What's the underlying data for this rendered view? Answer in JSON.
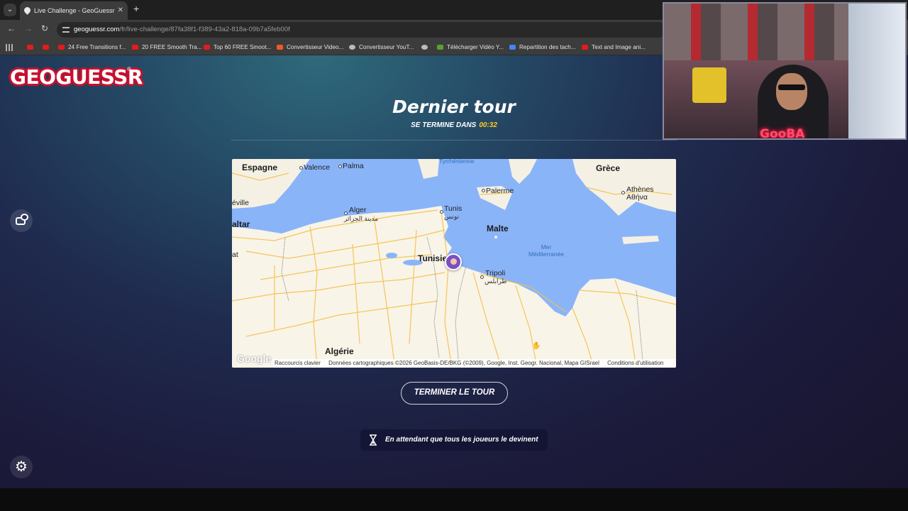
{
  "browser": {
    "tab_title": "Live Challenge - GeoGuessr",
    "url_host": "geoguessr.com",
    "url_path": "/fr/live-challenge/87fa38f1-f389-43a2-818a-09b7a5feb00f",
    "bookmarks": [
      {
        "label": "",
        "icon": "youtube-icon"
      },
      {
        "label": "",
        "icon": "youtube-icon"
      },
      {
        "label": "24 Free Transitions f...",
        "icon": "youtube-icon"
      },
      {
        "label": "20 FREE Smooth Tra...",
        "icon": "youtube-icon"
      },
      {
        "label": "Top 60 FREE Smoot...",
        "icon": "youtube-icon"
      },
      {
        "label": "Convertisseur Video...",
        "icon": "z-icon"
      },
      {
        "label": "Convertisseur YouT...",
        "icon": "converter-icon"
      },
      {
        "label": "",
        "icon": "globe-icon"
      },
      {
        "label": "Télécharger Vidéo Y...",
        "icon": "download-icon"
      },
      {
        "label": "Repartition des tach...",
        "icon": "docs-icon"
      },
      {
        "label": "Text and Image ani...",
        "icon": "youtube-icon"
      }
    ]
  },
  "game": {
    "logo_text": "GEOGUESSR",
    "logo_reg": "®",
    "round_title": "Dernier tour",
    "timer_label": "SE TERMINE DANS",
    "timer_value": "00:32",
    "end_button": "TERMINER LE TOUR",
    "waiting_text": "En attendant que tous les joueurs le devinent"
  },
  "map": {
    "labels": {
      "espagne": "Espagne",
      "valence": "Valence",
      "palma": "Palma",
      "tyrrhenienne": "Tyrrhénienne",
      "grece": "Grèce",
      "palerme": "Palerme",
      "athenes": "Athènes",
      "athenes_gr": "Αθήνα",
      "seville": "éville",
      "alger": "Alger",
      "alger_ar": "مدينة الجزائر",
      "tunis": "Tunis",
      "tunis_ar": "تونس",
      "malte": "Malte",
      "ltar": "altar",
      "at": "at",
      "mer": "Mer\nMéditerranée",
      "tunisie": "Tunisie",
      "tripoli": "Tripoli",
      "tripoli_ar": "طرابلس",
      "algerie": "Algérie"
    },
    "google": "Google",
    "footer": {
      "shortcuts": "Raccourcis clavier",
      "data": "Données cartographiques ©2026 GeoBasis-DE/BKG (©2009), Google, Inst. Geogr. Nacional, Mapa GISrael",
      "terms": "Conditions d'utilisation"
    }
  },
  "webcam": {
    "name": "GooBA"
  },
  "colors": {
    "timer": "#fecd19",
    "logo_red": "#c8102e",
    "water": "#8ab4f8",
    "land": "#f8f4e8",
    "roads": "#f5c04a"
  }
}
